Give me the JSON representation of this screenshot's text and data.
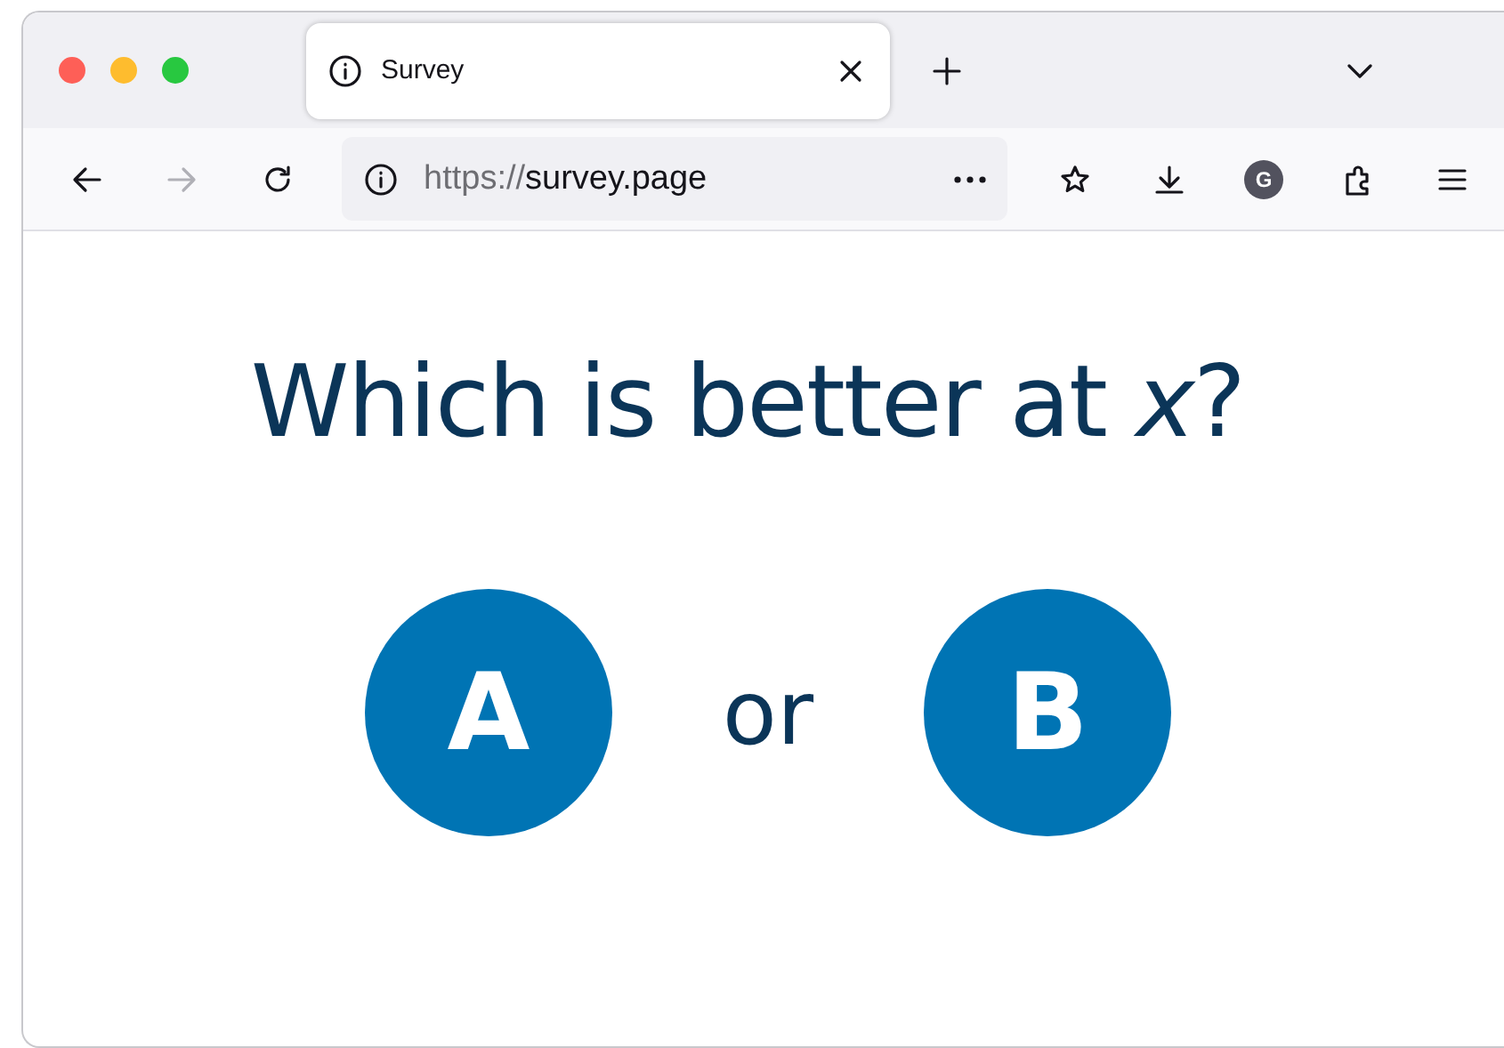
{
  "tab": {
    "title": "Survey",
    "selected": true
  },
  "address": {
    "scheme": "https://",
    "host": "survey.page"
  },
  "account": {
    "initial": "G"
  },
  "page": {
    "heading": "Which is better at *x*?",
    "options": [
      {
        "label": "A"
      },
      {
        "label": "B"
      }
    ],
    "separator": "or"
  }
}
